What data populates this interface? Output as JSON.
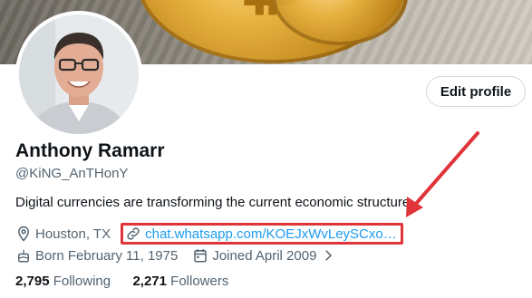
{
  "profile": {
    "name": "Anthony Ramarr",
    "handle": "@KiNG_AnTHonY",
    "bio": "Digital currencies are transforming the current economic structure.",
    "location": "Houston, TX",
    "link": "chat.whatsapp.com/KOEJxWvLeySCxo…",
    "born": "Born February 11, 1975",
    "joined": "Joined April 2009"
  },
  "actions": {
    "edit_profile": "Edit profile"
  },
  "stats": {
    "following_count": "2,795",
    "following_label": "Following",
    "followers_count": "2,271",
    "followers_label": "Followers"
  },
  "colors": {
    "link": "#1d9bf0",
    "annotation": "#e0343a",
    "secondary_text": "#536471"
  },
  "icons": [
    "location-icon",
    "link-icon",
    "birthday-icon",
    "calendar-icon",
    "chevron-right-icon"
  ]
}
